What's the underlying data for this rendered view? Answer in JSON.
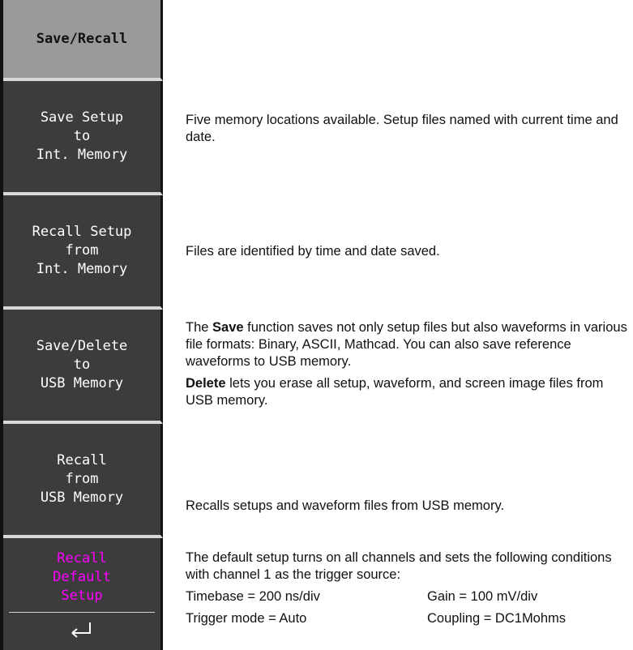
{
  "menu": {
    "title": "Save/Recall",
    "buttons": [
      {
        "lines": [
          "Save Setup",
          "to",
          "Int. Memory"
        ]
      },
      {
        "lines": [
          "Recall Setup",
          "from",
          "Int. Memory"
        ]
      },
      {
        "lines": [
          "Save/Delete",
          "to",
          "USB Memory"
        ]
      },
      {
        "lines": [
          "Recall",
          "from",
          "USB Memory"
        ]
      },
      {
        "lines": [
          "Recall",
          "Default",
          "Setup"
        ]
      }
    ]
  },
  "descriptions": {
    "save_setup": "Five memory locations available. Setup files named with current time and date.",
    "recall_setup": "Files are identified by time and date saved.",
    "save_usb": {
      "p1_bold": "Save",
      "p1_rest": " function saves not only setup files but also waveforms in various file formats: Binary, ASCII, Mathcad. You can also save reference waveforms to USB memory.",
      "p1_prefix": "The ",
      "p2_bold": "Delete",
      "p2_rest": " lets you erase all setup, waveform, and screen image files from USB memory."
    },
    "recall_usb": "Recalls setups and waveform files from USB memory.",
    "default_setup": {
      "intro": "The default setup turns on all channels and sets the following conditions with channel 1 as the trigger source:",
      "rows": [
        {
          "left": "Timebase = 200 ns/div",
          "right": "Gain = 100 mV/div"
        },
        {
          "left": "Trigger mode = Auto",
          "right": "Coupling = DC1Mohms"
        }
      ]
    }
  },
  "colors": {
    "button_bg": "#3c3c3c",
    "title_bg": "#9a9a9a",
    "highlight_text": "#ff00ff"
  },
  "icons": {
    "enter": "enter-icon"
  }
}
